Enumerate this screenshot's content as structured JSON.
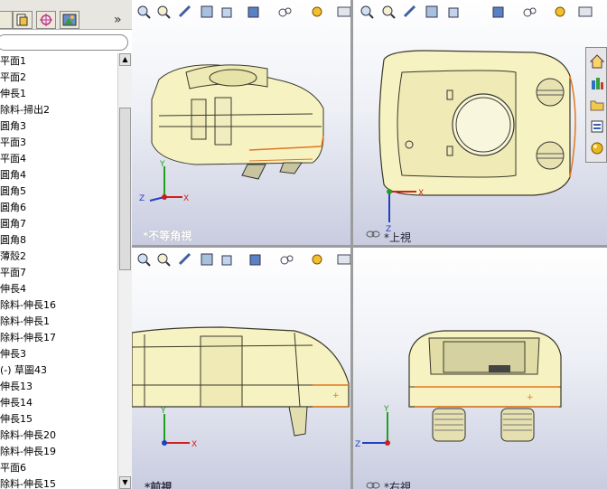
{
  "feature_tree": {
    "items": [
      {
        "label": "平面1"
      },
      {
        "label": "平面2"
      },
      {
        "label": "伸長1"
      },
      {
        "label": "除料-掃出2"
      },
      {
        "label": "圓角3"
      },
      {
        "label": "平面3"
      },
      {
        "label": "平面4"
      },
      {
        "label": "圓角4"
      },
      {
        "label": "圓角5"
      },
      {
        "label": "圓角6"
      },
      {
        "label": "圓角7"
      },
      {
        "label": "圓角8"
      },
      {
        "label": "薄殼2"
      },
      {
        "label": "平面7"
      },
      {
        "label": "伸長4"
      },
      {
        "label": "除料-伸長16"
      },
      {
        "label": "除料-伸長1"
      },
      {
        "label": "除料-伸長17"
      },
      {
        "label": "伸長3"
      },
      {
        "label": "(-) 草圖43"
      },
      {
        "label": "伸長13"
      },
      {
        "label": "伸長14"
      },
      {
        "label": "伸長15"
      },
      {
        "label": "除料-伸長20"
      },
      {
        "label": "除料-伸長19"
      },
      {
        "label": "平面6"
      },
      {
        "label": "除料-伸長15"
      }
    ],
    "more_glyph": "»"
  },
  "viewports": {
    "iso": {
      "label": "*不等角視"
    },
    "top": {
      "label": "*上視"
    },
    "front": {
      "label": "*前視"
    },
    "right": {
      "label": "*右視"
    }
  },
  "axes": {
    "x": "X",
    "y": "Y",
    "z": "Z"
  },
  "colors": {
    "model_fill": "#f6f2c2",
    "model_edge": "#3a3a2a",
    "highlight": "#e07820"
  }
}
